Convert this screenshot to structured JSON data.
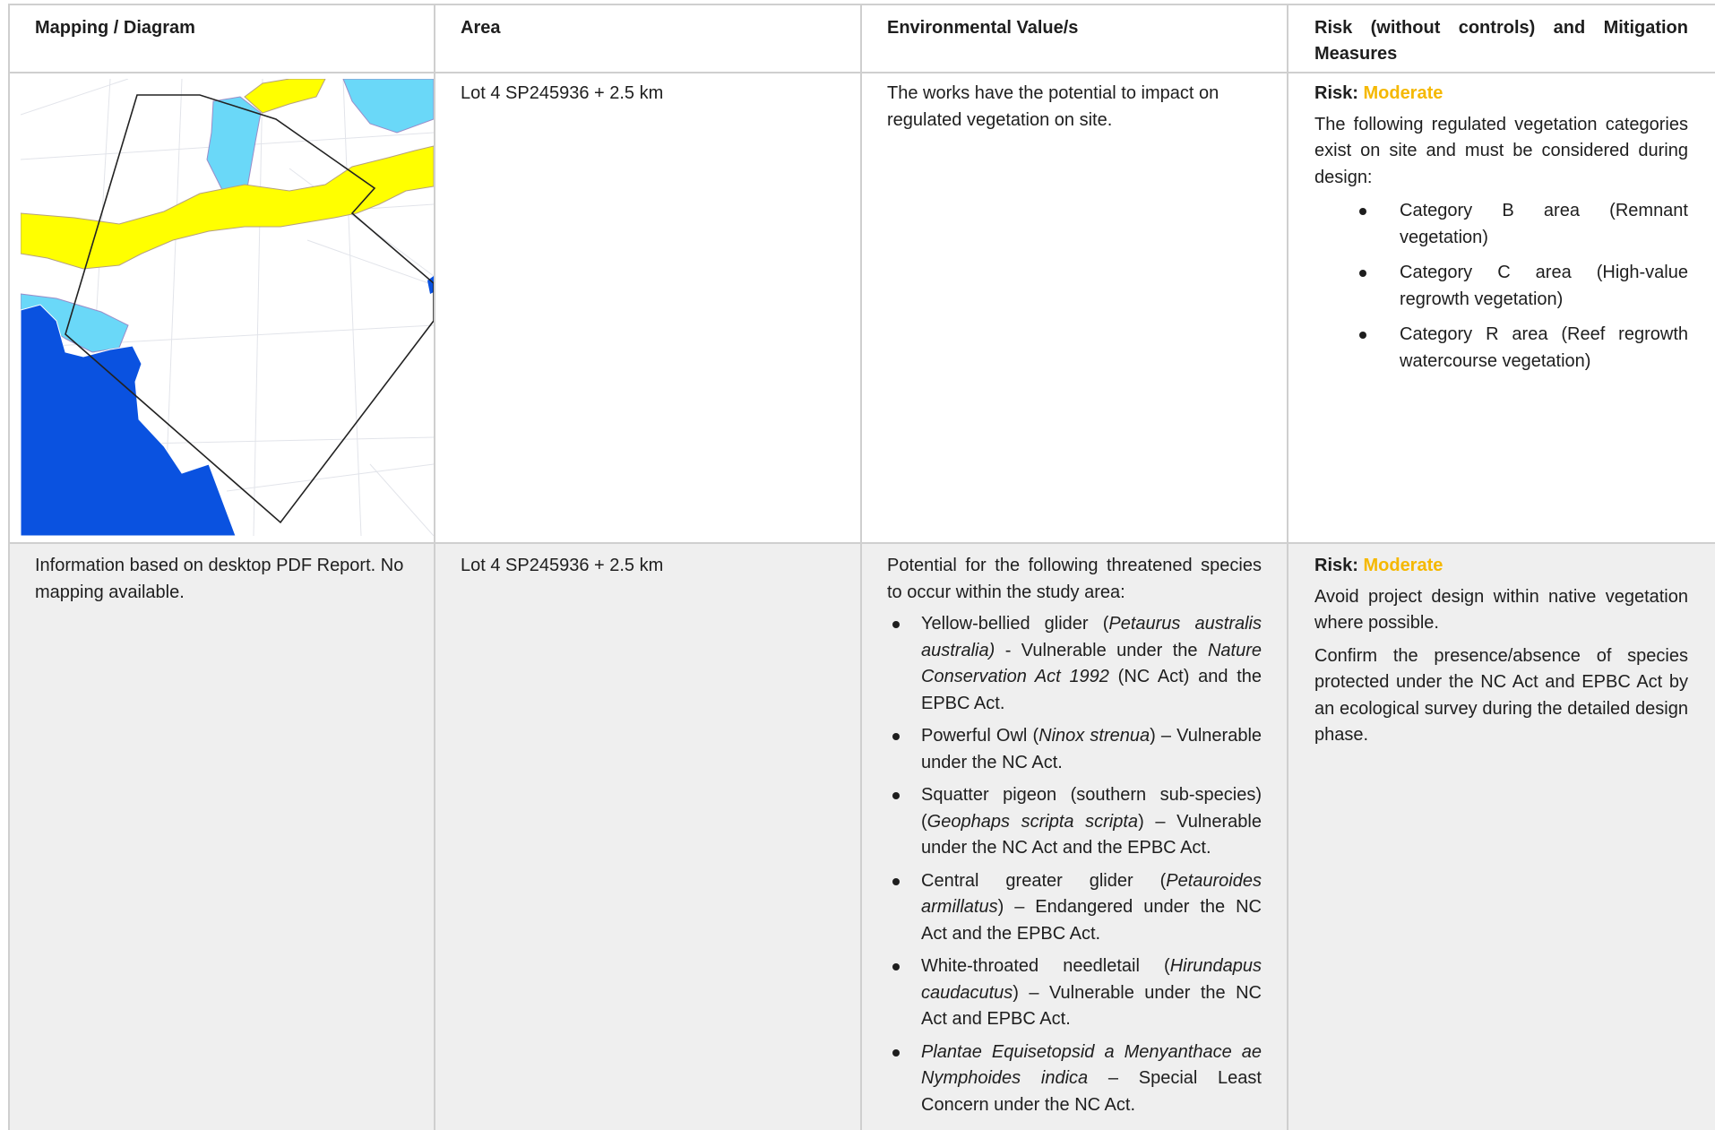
{
  "table": {
    "headers": {
      "mapping": "Mapping / Diagram",
      "area": "Area",
      "environmental": "Environmental Value/s",
      "risk": "Risk (without controls) and Mitigation Measures"
    },
    "row1": {
      "area": "Lot 4 SP245936 + 2.5 km",
      "value": "The works have the potential to impact on regulated vegetation on site.",
      "risk_label": "Risk: ",
      "risk_level": "Moderate",
      "risk_intro": "The following regulated vegetation categories exist on site and must be considered during design:",
      "categories": [
        "Category B area (Remnant vegetation)",
        "Category C area (High-value regrowth vegetation)",
        "Category R area (Reef regrowth watercourse vegetation)"
      ],
      "map_colors": {
        "regulated_yellow": "#ffff00",
        "watercourse_light_blue": "#6ad8f8",
        "remnant_blue": "#0a52e0"
      }
    },
    "row2": {
      "mapping": "Information based on desktop PDF Report. No mapping available.",
      "area": "Lot 4 SP245936 + 2.5 km",
      "value_intro": "Potential for the following threatened species to occur within the study area:",
      "species": [
        {
          "pre": "Yellow-bellied glider (",
          "sci": "Petaurus australis australia)",
          "post": " - Vulnerable under the ",
          "act": "Nature Conservation Act 1992",
          "post2": " (NC Act) and the EPBC Act."
        },
        {
          "pre": "Powerful Owl (",
          "sci": "Ninox strenua",
          "post": ") – Vulnerable under the NC Act."
        },
        {
          "pre": "Squatter pigeon (southern sub-species) (",
          "sci": "Geophaps scripta scripta",
          "post": ") – Vulnerable under the NC Act and the EPBC Act."
        },
        {
          "pre": "Central greater glider (",
          "sci": "Petauroides armillatus",
          "post": ") – Endangered under the NC Act and the EPBC Act."
        },
        {
          "pre": "White-throated needletail (",
          "sci": "Hirundapus caudacutus",
          "post": ") – Vulnerable under the NC Act and EPBC Act."
        },
        {
          "pre": "",
          "sci": "Plantae Equisetopsid a Menyanthace ae Nymphoides indica",
          "post": " – Special Least Concern under the NC Act."
        }
      ],
      "risk_label": "Risk: ",
      "risk_level": "Moderate",
      "mitigation": [
        "Avoid project design within native vegetation where possible.",
        "Confirm the presence/absence of species protected under the NC Act and EPBC Act by an ecological survey during the detailed design phase."
      ]
    }
  }
}
